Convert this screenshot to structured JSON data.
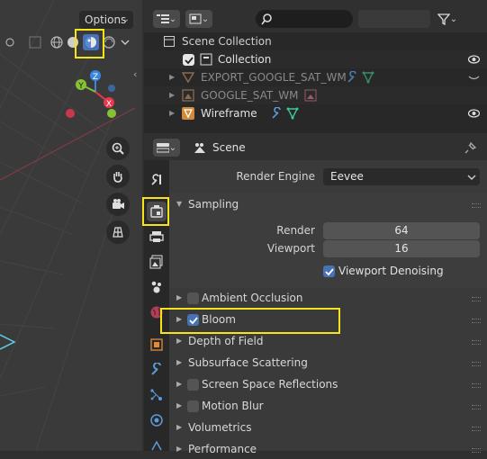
{
  "viewport": {
    "options_label": "Options",
    "axes": {
      "x": "X",
      "y": "Y",
      "z": "Z"
    }
  },
  "outliner": {
    "rows": [
      {
        "label": "Scene Collection"
      },
      {
        "label": "Collection"
      },
      {
        "label": "EXPORT_GOOGLE_SAT_WM"
      },
      {
        "label": "GOOGLE_SAT_WM"
      },
      {
        "label": "Wireframe"
      }
    ]
  },
  "properties": {
    "header_title": "Scene",
    "render_engine_label": "Render Engine",
    "render_engine_value": "Eevee",
    "sampling": {
      "title": "Sampling",
      "render_label": "Render",
      "render_value": "64",
      "viewport_label": "Viewport",
      "viewport_value": "16",
      "denoise_label": "Viewport Denoising"
    },
    "panels": [
      {
        "label": "Ambient Occlusion",
        "checkbox": "off"
      },
      {
        "label": "Bloom",
        "checkbox": "on"
      },
      {
        "label": "Depth of Field",
        "checkbox": "none"
      },
      {
        "label": "Subsurface Scattering",
        "checkbox": "none"
      },
      {
        "label": "Screen Space Reflections",
        "checkbox": "off"
      },
      {
        "label": "Motion Blur",
        "checkbox": "off"
      },
      {
        "label": "Volumetrics",
        "checkbox": "none"
      },
      {
        "label": "Performance",
        "checkbox": "none"
      }
    ]
  },
  "colors": {
    "highlight": "#f5e41a",
    "accent_blue": "#4772b3",
    "axis_x": "#e8374f",
    "axis_y": "#86c232",
    "axis_z": "#3b86e0"
  }
}
